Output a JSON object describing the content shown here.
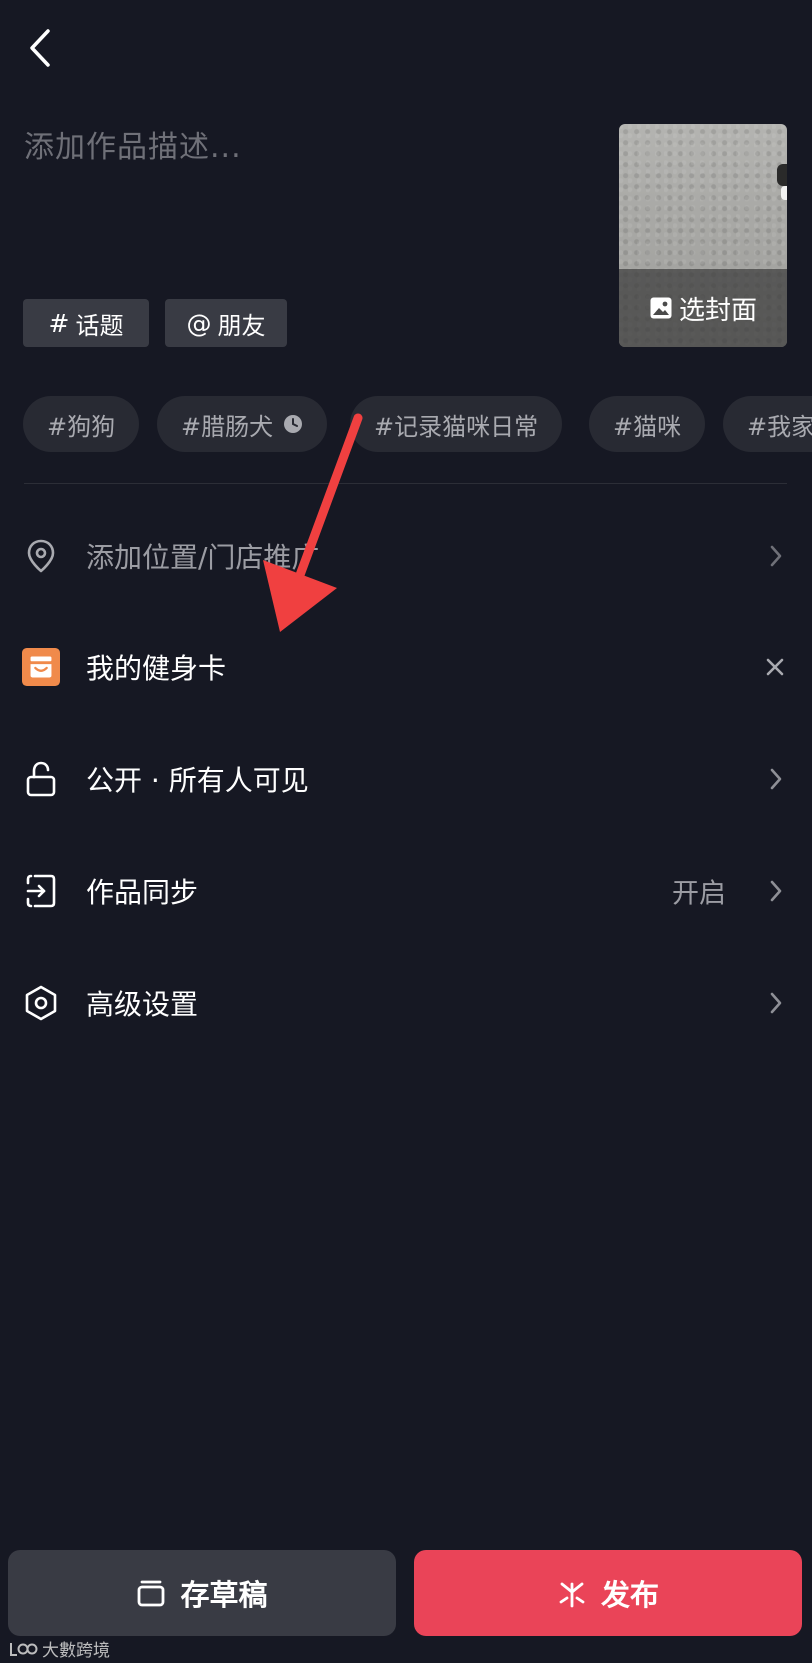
{
  "header": {
    "back_icon": "chevron-left-icon"
  },
  "description": {
    "placeholder": "添加作品描述..."
  },
  "cover": {
    "label": "选封面",
    "icon": "image-icon"
  },
  "chips": [
    {
      "symbol": "#",
      "label": "话题"
    },
    {
      "symbol": "@",
      "label": "朋友"
    }
  ],
  "hashtags": [
    {
      "label": "#狗狗"
    },
    {
      "label": "#腊肠犬",
      "icon": "clock-icon"
    },
    {
      "label": "#记录猫咪日常"
    },
    {
      "label": "#猫咪"
    },
    {
      "label": "#我家"
    }
  ],
  "rows": {
    "location": {
      "label": "添加位置/门店推广",
      "icon": "location-pin-icon"
    },
    "fitness_card": {
      "label": "我的健身卡",
      "icon": "store-icon",
      "icon_color": "#f08a4b"
    },
    "visibility": {
      "label": "公开 · 所有人可见",
      "icon": "unlock-icon"
    },
    "sync": {
      "label": "作品同步",
      "value": "开启",
      "icon": "sync-icon"
    },
    "advanced": {
      "label": "高级设置",
      "icon": "hexagon-settings-icon"
    }
  },
  "buttons": {
    "draft": "存草稿",
    "publish": "发布"
  },
  "watermark": {
    "text": "大數跨境"
  },
  "colors": {
    "background": "#161823",
    "publish": "#ea4458",
    "annotation_arrow": "#f04040"
  }
}
